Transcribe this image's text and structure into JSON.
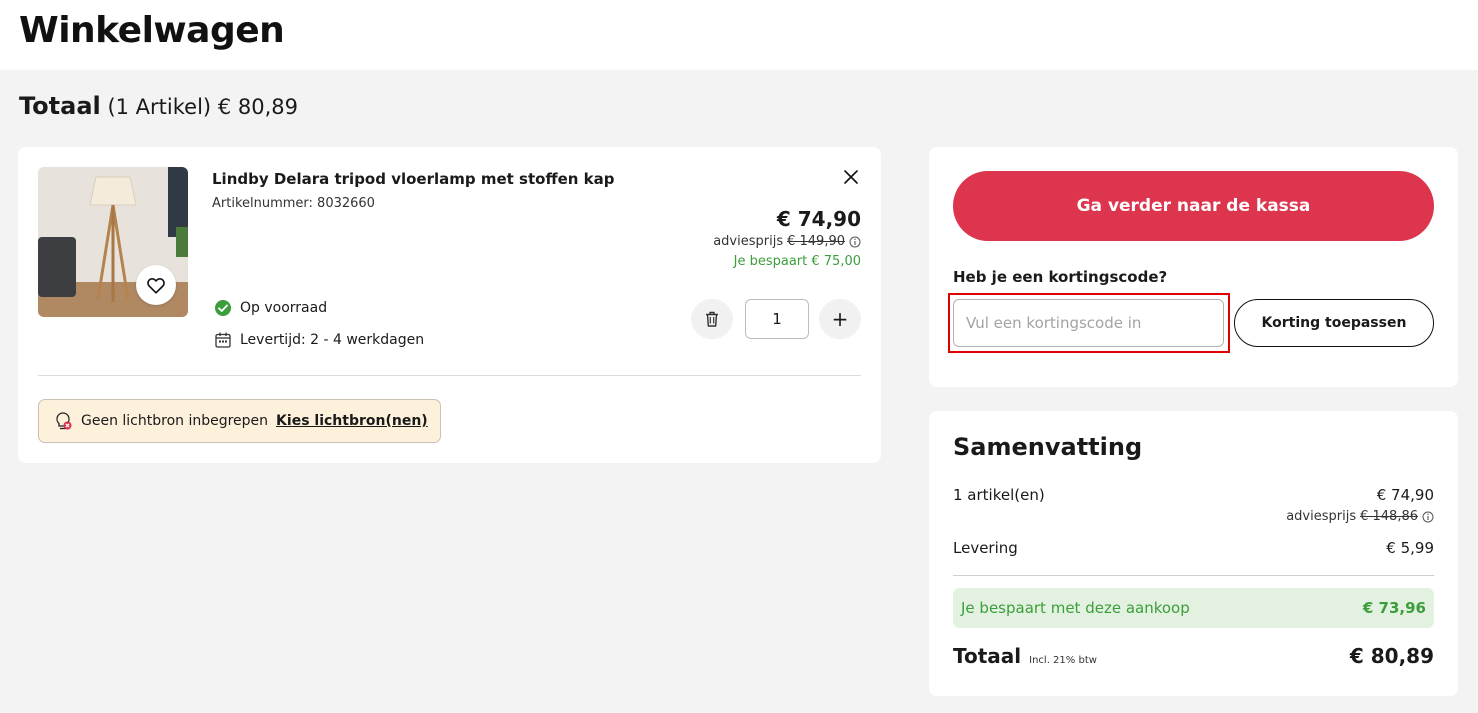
{
  "header": {
    "title": "Winkelwagen"
  },
  "totals": {
    "label": "Totaal",
    "count": "(1 Artikel)",
    "amount": "€ 80,89"
  },
  "item": {
    "name": "Lindby Delara tripod vloerlamp met stoffen kap",
    "sku": "Artikelnummer: 8032660",
    "price": "€ 74,90",
    "advies_label": "adviesprijs",
    "advies_price": "€ 149,90",
    "savings": "Je bespaart € 75,00",
    "stock": "Op voorraad",
    "delivery": "Levertijd: 2 - 4 werkdagen",
    "quantity": "1",
    "plus": "+",
    "light_notice": "Geen lichtbron inbegrepen",
    "light_link": "Kies lichtbron(nen)"
  },
  "checkout": {
    "button": "Ga verder naar de kassa",
    "coupon_question": "Heb je een kortingscode?",
    "coupon_placeholder": "Vul een kortingscode in",
    "apply_button": "Korting toepassen"
  },
  "summary": {
    "title": "Samenvatting",
    "items_label": "1 artikel(en)",
    "items_value": "€ 74,90",
    "advies_label": "adviesprijs",
    "advies_value": "€ 148,86",
    "delivery_label": "Levering",
    "delivery_value": "€ 5,99",
    "savings_label": "Je bespaart met deze aankoop",
    "savings_value": "€ 73,96",
    "total_label": "Totaal",
    "vat_note": "Incl. 21% btw",
    "total_value": "€ 80,89"
  },
  "colors": {
    "primary": "#dc354d",
    "success": "#3b9e3b",
    "highlight": "#e00000",
    "notice_bg": "#fdf1dc"
  },
  "icons": [
    "heart-icon",
    "close-icon",
    "info-icon",
    "check-circle-icon",
    "calendar-icon",
    "trash-icon",
    "bulb-off-icon"
  ]
}
